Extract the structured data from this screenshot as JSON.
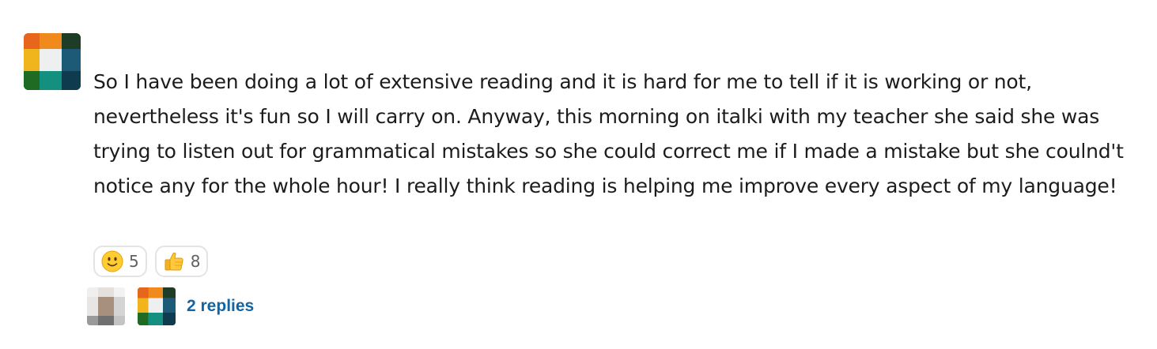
{
  "message": {
    "text": "So I have been doing a lot of extensive reading and it is hard for me to tell if it is working or not, nevertheless it's fun so I will carry on. Anyway, this morning on italki with my teacher she said she was trying to listen out for grammatical mistakes so she could correct me if I made a mistake but she coulnd't notice any for the whole hour! I really think reading is helping me improve every aspect of my language!"
  },
  "reactions": [
    {
      "emoji": "slightly-smiling-face-icon",
      "count": "5"
    },
    {
      "emoji": "thumbs-up-icon",
      "count": "8"
    }
  ],
  "thread": {
    "replies_label": "2 replies"
  },
  "colors": {
    "link": "#1264a3",
    "text": "#1d1c1d",
    "reaction_border": "#e4e4e4"
  }
}
